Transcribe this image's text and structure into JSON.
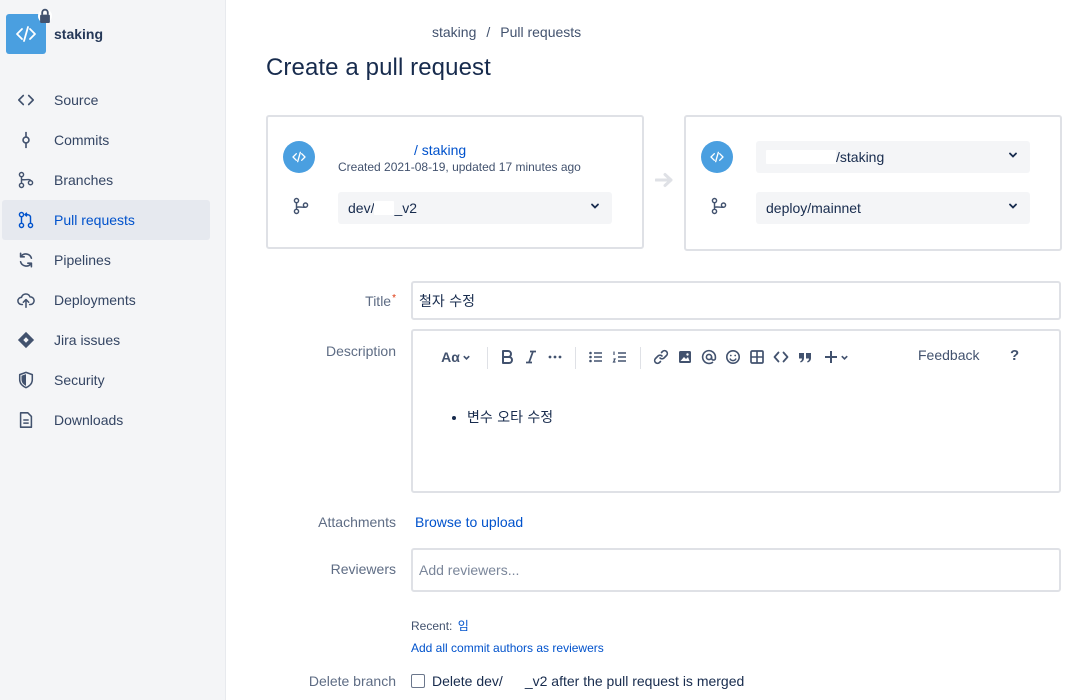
{
  "sidebar": {
    "repo_name": "staking",
    "items": [
      {
        "label": "Source",
        "icon": "source-code-icon"
      },
      {
        "label": "Commits",
        "icon": "commit-icon"
      },
      {
        "label": "Branches",
        "icon": "branch-icon"
      },
      {
        "label": "Pull requests",
        "icon": "pull-request-icon",
        "active": true
      },
      {
        "label": "Pipelines",
        "icon": "pipelines-icon"
      },
      {
        "label": "Deployments",
        "icon": "cloud-upload-icon"
      },
      {
        "label": "Jira issues",
        "icon": "jira-icon"
      },
      {
        "label": "Security",
        "icon": "shield-icon"
      },
      {
        "label": "Downloads",
        "icon": "document-icon"
      }
    ]
  },
  "breadcrumb": {
    "repo": "staking",
    "separator": "/",
    "page": "Pull requests"
  },
  "page_title": "Create a pull request",
  "source": {
    "repo_label": "/ staking",
    "meta": "Created 2021-08-19, updated 17 minutes ago",
    "branch_prefix": "dev/",
    "branch_suffix": "_v2"
  },
  "destination": {
    "repo_label": "/staking",
    "branch": "deploy/mainnet"
  },
  "form": {
    "title_label": "Title",
    "title_value": "철자 수정",
    "description_label": "Description",
    "description_items": [
      "변수 오타 수정"
    ],
    "toolbar": {
      "text_style": "Aα",
      "feedback": "Feedback",
      "help": "?"
    },
    "attachments_label": "Attachments",
    "browse_label": "Browse to upload",
    "reviewers_label": "Reviewers",
    "reviewers_placeholder": "Add reviewers...",
    "recent_label": "Recent:",
    "recent_user": "임",
    "add_all_label": "Add all commit authors as reviewers",
    "delete_branch_label": "Delete branch",
    "delete_prefix": "Delete dev/",
    "delete_suffix": "_v2 after the pull request is merged"
  },
  "colors": {
    "accent": "#0052cc",
    "repo_avatar": "#4a9fe0",
    "required": "#de350b"
  }
}
